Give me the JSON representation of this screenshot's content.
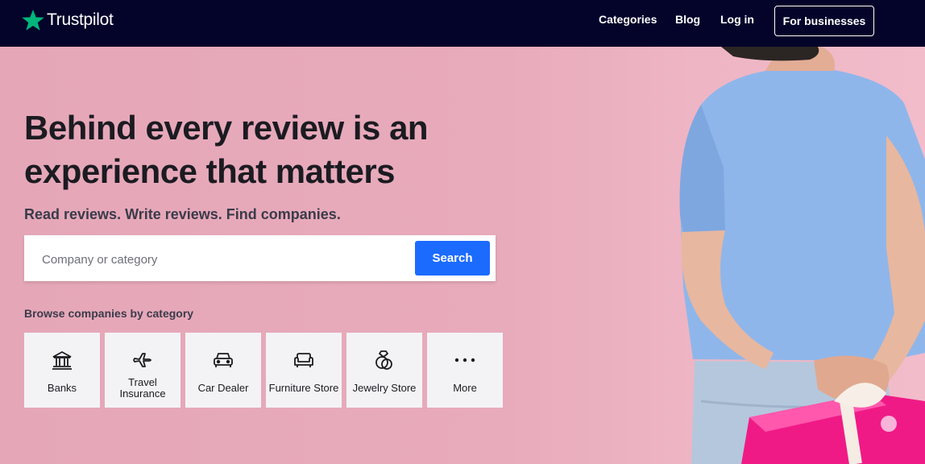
{
  "nav": {
    "brand": "Trustpilot",
    "links": [
      "Categories",
      "Blog",
      "Log in"
    ],
    "business_button": "For businesses"
  },
  "hero": {
    "headline_line1": "Behind every review is an",
    "headline_line2": "experience that matters",
    "subheading": "Read reviews. Write reviews. Find companies.",
    "search": {
      "placeholder": "Company or category",
      "button": "Search"
    },
    "browse_title": "Browse companies by category",
    "categories": [
      {
        "icon": "bank-icon",
        "label": "Banks"
      },
      {
        "icon": "airplane-icon",
        "label": "Travel Insurance"
      },
      {
        "icon": "car-icon",
        "label": "Car Dealer"
      },
      {
        "icon": "sofa-icon",
        "label": "Furniture Store"
      },
      {
        "icon": "ring-icon",
        "label": "Jewelry Store"
      },
      {
        "icon": "more-dots-icon",
        "label": "More"
      }
    ]
  },
  "colors": {
    "nav_bg": "#04032a",
    "brand_green": "#00b67a",
    "hero_bg": "#e8a9ba",
    "search_button": "#1c6bff",
    "category_tile": "#f3f3f6"
  }
}
